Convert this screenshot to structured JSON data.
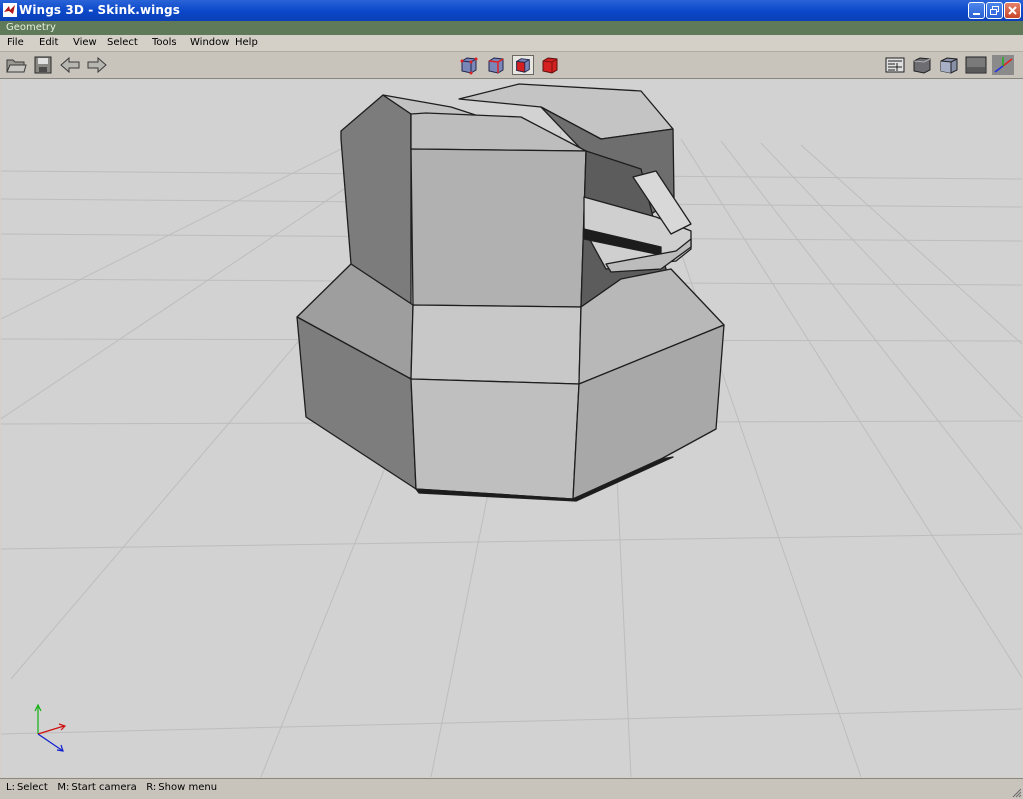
{
  "window": {
    "title": "Wings 3D - Skink.wings",
    "controls": [
      "minimize-icon",
      "maximize-icon",
      "close-icon"
    ]
  },
  "mode_bar": {
    "title": "Geometry"
  },
  "menu": {
    "items": [
      {
        "label": "File"
      },
      {
        "label": "Edit"
      },
      {
        "label": "View"
      },
      {
        "label": "Select"
      },
      {
        "label": "Tools"
      },
      {
        "label": "Window"
      },
      {
        "label": "Help"
      }
    ]
  },
  "toolbar": {
    "file_icons": [
      "open-folder-icon",
      "save-icon",
      "undo-arrow-icon",
      "redo-arrow-icon"
    ],
    "selection_modes": [
      "vertex-mode-icon",
      "edge-mode-icon",
      "face-mode-icon",
      "body-mode-icon"
    ],
    "active_selection_mode": "face-mode-icon",
    "view_icons": [
      "wireframe-toggle-icon",
      "smooth-shade-icon",
      "flat-shade-icon",
      "groundplane-icon",
      "axes-icon"
    ]
  },
  "status": {
    "hints": [
      {
        "key": "L:",
        "text": "Select"
      },
      {
        "key": "M:",
        "text": "Start camera"
      },
      {
        "key": "R:",
        "text": "Show menu"
      }
    ]
  },
  "viewport": {
    "background": "#d2d2d2",
    "grid_color": "#bdbdbd",
    "axis_colors": {
      "x": "#d01010",
      "y": "#10b010",
      "z": "#1020d0"
    }
  },
  "colors": {
    "titlebar": "#0a47c8",
    "mode_bar": "#5f7a58",
    "selection_red": "#d42020"
  }
}
